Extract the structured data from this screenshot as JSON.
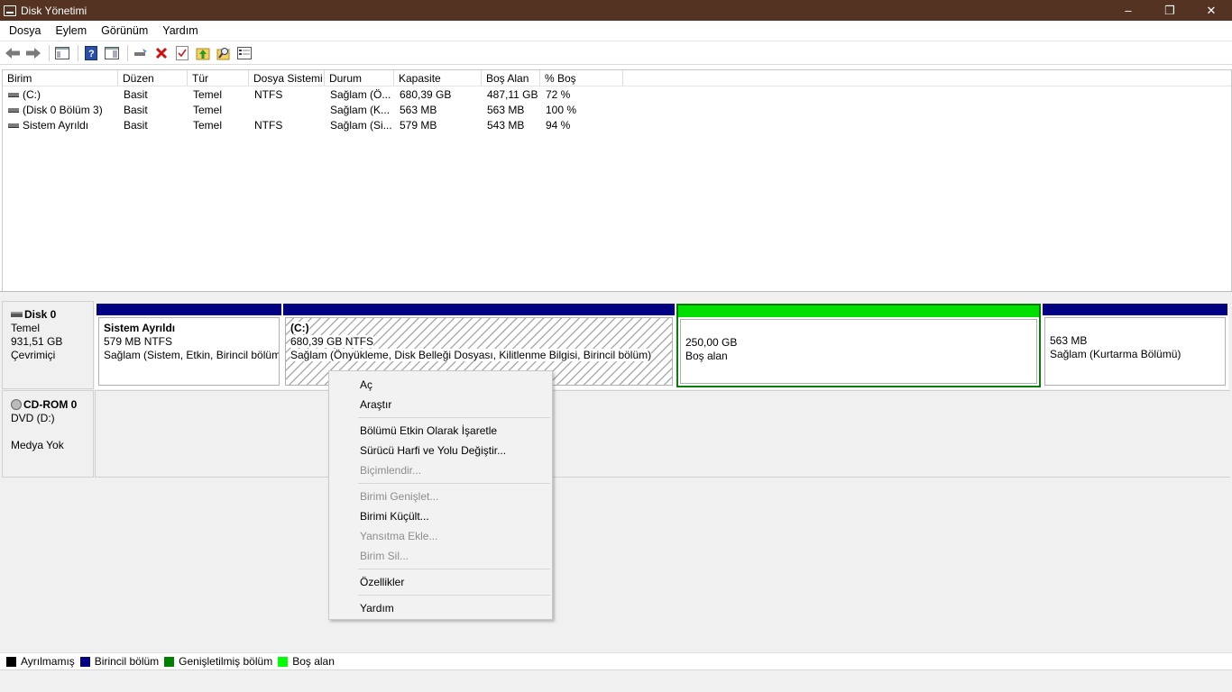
{
  "window": {
    "title": "Disk Yönetimi"
  },
  "menubar": [
    "Dosya",
    "Eylem",
    "Görünüm",
    "Yardım"
  ],
  "toolbar": {
    "icons": [
      "back-icon",
      "forward-icon",
      "console-tree-icon",
      "help-icon",
      "show-pane-icon",
      "connect-icon",
      "delete-icon",
      "check-icon",
      "up-icon",
      "search-icon",
      "properties-icon"
    ]
  },
  "volume_list": {
    "columns": [
      "Birim",
      "Düzen",
      "Tür",
      "Dosya Sistemi",
      "Durum",
      "Kapasite",
      "Boş Alan",
      "% Boş"
    ],
    "rows": [
      [
        "(C:)",
        "Basit",
        "Temel",
        "NTFS",
        "Sağlam (Ö...",
        "680,39 GB",
        "487,11 GB",
        "72 %"
      ],
      [
        "(Disk 0 Bölüm 3)",
        "Basit",
        "Temel",
        "",
        "Sağlam (K...",
        "563 MB",
        "563 MB",
        "100 %"
      ],
      [
        "Sistem Ayrıldı",
        "Basit",
        "Temel",
        "NTFS",
        "Sağlam (Si...",
        "579 MB",
        "543 MB",
        "94 %"
      ]
    ]
  },
  "disk0": {
    "name": "Disk 0",
    "type": "Temel",
    "size": "931,51 GB",
    "status": "Çevrimiçi",
    "partitions": [
      {
        "name": "Sistem Ayrıldı",
        "size": "579 MB NTFS",
        "status": "Sağlam (Sistem, Etkin, Birincil bölüm)"
      },
      {
        "name": "(C:)",
        "size": "680,39 GB NTFS",
        "status": "Sağlam (Önyükleme, Disk Belleği Dosyası, Kilitlenme Bilgisi, Birincil bölüm)"
      },
      {
        "name": "",
        "size": "250,00 GB",
        "status": "Boş alan"
      },
      {
        "name": "",
        "size": "563 MB",
        "status": "Sağlam (Kurtarma Bölümü)"
      }
    ]
  },
  "cdrom0": {
    "name": "CD-ROM 0",
    "drive": "DVD (D:)",
    "status": "Medya Yok"
  },
  "legend": [
    {
      "label": "Ayrılmamış",
      "color": "#000000"
    },
    {
      "label": "Birincil bölüm",
      "color": "#000080"
    },
    {
      "label": "Genişletilmiş bölüm",
      "color": "#008000"
    },
    {
      "label": "Boş alan",
      "color": "#00ff00"
    }
  ],
  "context_menu": {
    "groups": [
      [
        {
          "label": "Aç",
          "enabled": true
        },
        {
          "label": "Araştır",
          "enabled": true
        }
      ],
      [
        {
          "label": "Bölümü Etkin Olarak İşaretle",
          "enabled": true
        },
        {
          "label": "Sürücü Harfi ve Yolu Değiştir...",
          "enabled": true
        },
        {
          "label": "Biçimlendir...",
          "enabled": false
        }
      ],
      [
        {
          "label": "Birimi Genişlet...",
          "enabled": false
        },
        {
          "label": "Birimi Küçült...",
          "enabled": true
        },
        {
          "label": "Yansıtma Ekle...",
          "enabled": false
        },
        {
          "label": "Birim Sil...",
          "enabled": false
        }
      ],
      [
        {
          "label": "Özellikler",
          "enabled": true
        }
      ],
      [
        {
          "label": "Yardım",
          "enabled": true
        }
      ]
    ]
  }
}
